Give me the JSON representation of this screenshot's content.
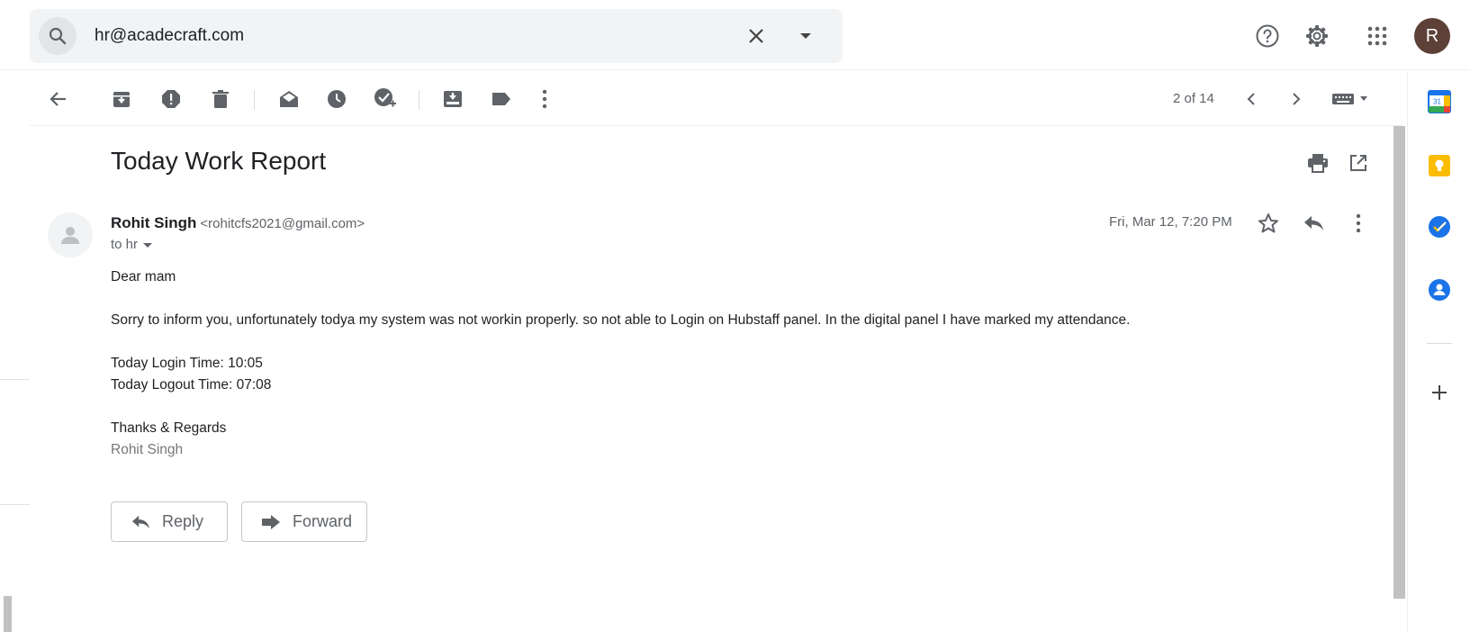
{
  "search": {
    "query": "hr@acadecraft.com",
    "search_icon": "search-icon",
    "clear_icon": "close-icon",
    "options_icon": "caret-down-icon"
  },
  "header": {
    "help_icon": "help-icon",
    "settings_icon": "gear-icon",
    "apps_icon": "apps-grid-icon",
    "avatar_initial": "R",
    "avatar_color": "#5d4037"
  },
  "toolbar": {
    "icons": [
      "back-arrow-icon",
      "archive-icon",
      "report-spam-icon",
      "delete-icon",
      "mark-unread-icon",
      "snooze-icon",
      "add-task-icon",
      "move-to-icon",
      "label-icon",
      "more-vert-icon"
    ],
    "pager": "2 of 14",
    "input_tools_icon": "keyboard-icon"
  },
  "message": {
    "subject": "Today Work Report",
    "sender_name": "Rohit Singh",
    "sender_email": "<rohitcfs2021@gmail.com>",
    "to_label": "to hr",
    "date": "Fri, Mar 12, 7:20 PM",
    "body": {
      "greeting": "Dear mam",
      "paragraph": "Sorry to inform you, unfortunately todya my system was not workin properly. so not able to Login on Hubstaff panel. In the digital panel I have marked my attendance.",
      "login_time": "Today Login Time: 10:05",
      "logout_time": "Today Logout Time: 07:08",
      "closing": "Thanks & Regards",
      "signature": "Rohit Singh"
    }
  },
  "actions": {
    "reply_label": "Reply",
    "forward_label": "Forward"
  },
  "side_panel": {
    "calendar_day": "31",
    "apps": [
      "calendar-icon",
      "keep-icon",
      "tasks-icon",
      "contacts-icon"
    ],
    "add_icon": "plus-icon"
  },
  "colors": {
    "keep": "#fbbc04",
    "tasks": "#1a73e8",
    "contacts": "#1a73e8",
    "icon_gray": "#5f6368"
  }
}
